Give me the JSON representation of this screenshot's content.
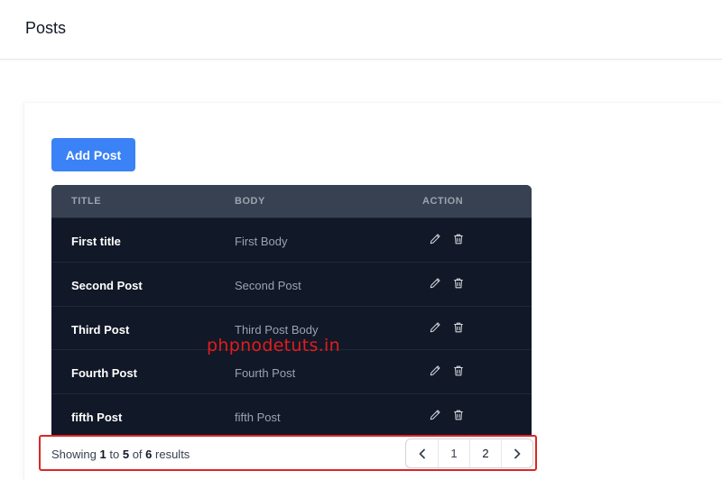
{
  "header": {
    "title": "Posts"
  },
  "toolbar": {
    "add_label": "Add Post"
  },
  "table": {
    "columns": [
      "TITLE",
      "BODY",
      "ACTION"
    ],
    "rows": [
      {
        "title": "First title",
        "body": "First Body"
      },
      {
        "title": "Second Post",
        "body": "Second Post"
      },
      {
        "title": "Third Post",
        "body": "Third Post Body"
      },
      {
        "title": "Fourth Post",
        "body": "Fourth Post"
      },
      {
        "title": "fifth Post",
        "body": "fifth Post"
      }
    ]
  },
  "watermark": "phpnodetuts.in",
  "pagination": {
    "showing": "Showing",
    "from": "1",
    "to_word": "to",
    "to": "5",
    "of_word": "of",
    "total": "6",
    "results_word": "results",
    "prev_symbol": "‹",
    "next_symbol": "›",
    "pages": [
      "1",
      "2"
    ]
  },
  "colors": {
    "accent": "#3b82f6",
    "table_bg": "#111827",
    "table_header_bg": "#374151",
    "highlight_border": "#dc2626",
    "watermark": "#e11d1d"
  },
  "icons": {
    "edit": "pencil-icon",
    "delete": "trash-icon",
    "prev": "chevron-left-icon",
    "next": "chevron-right-icon"
  }
}
